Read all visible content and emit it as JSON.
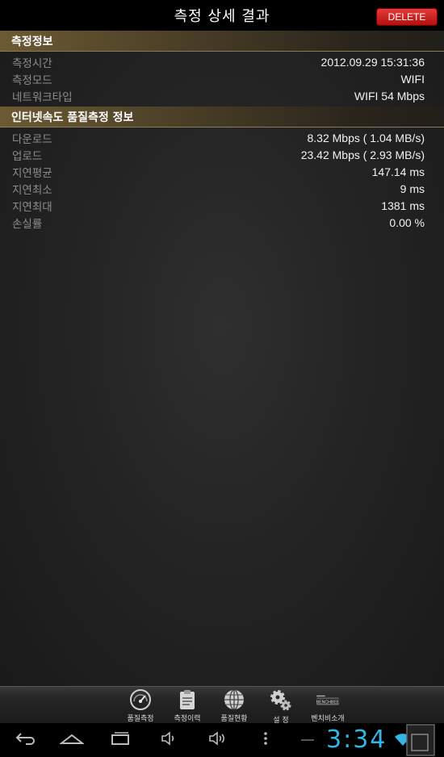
{
  "header": {
    "title": "측정 상세 결과",
    "delete_label": "DELETE"
  },
  "sections": [
    {
      "title": "측정정보",
      "rows": [
        {
          "label": "측정시간",
          "value": "2012.09.29 15:31:36"
        },
        {
          "label": "측정모드",
          "value": "WIFI"
        },
        {
          "label": "네트워크타입",
          "value": "WIFI 54 Mbps"
        }
      ]
    },
    {
      "title": "인터넷속도 품질측정 정보",
      "rows": [
        {
          "label": "다운로드",
          "value": "8.32 Mbps ( 1.04 MB/s)"
        },
        {
          "label": "업로드",
          "value": "23.42 Mbps ( 2.93 MB/s)"
        },
        {
          "label": "지연평균",
          "value": "147.14 ms"
        },
        {
          "label": "지연최소",
          "value": "9 ms"
        },
        {
          "label": "지연최대",
          "value": "1381 ms"
        },
        {
          "label": "손실률",
          "value": "0.00 %"
        }
      ]
    }
  ],
  "bottom_nav": {
    "items": [
      {
        "label": "품질측정",
        "icon": "speedometer-icon"
      },
      {
        "label": "측정이력",
        "icon": "clipboard-icon"
      },
      {
        "label": "품질현황",
        "icon": "globe-icon"
      },
      {
        "label": "설 정",
        "icon": "gears-icon"
      },
      {
        "label": "벤치비소개",
        "icon": "benchbee-logo-icon",
        "logo_text": "BENCHBEE"
      }
    ]
  },
  "system_bar": {
    "clock": "3:34",
    "accent_color": "#33b5e5"
  }
}
